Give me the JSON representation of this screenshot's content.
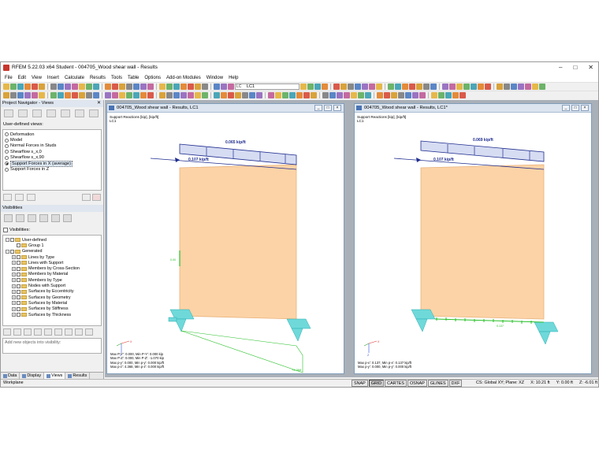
{
  "app": {
    "title": "RFEM 5.22.03 x64 Student - 004705_Wood shear wall - Results",
    "window_buttons": [
      "–",
      "□",
      "✕"
    ]
  },
  "menu": [
    "File",
    "Edit",
    "View",
    "Insert",
    "Calculate",
    "Results",
    "Tools",
    "Table",
    "Options",
    "Add-on Modules",
    "Window",
    "Help"
  ],
  "toolbar": {
    "load_case_tag": "LC",
    "load_case": "LC1"
  },
  "navigator": {
    "title": "Project Navigator - Views",
    "pin": "✕",
    "user_defined_label": "User-defined views:",
    "views": [
      {
        "label": "Deformation",
        "selected": false
      },
      {
        "label": "Model",
        "selected": false
      },
      {
        "label": "Normal Forces in Studs",
        "selected": false
      },
      {
        "label": "Shearflow s_x,0",
        "selected": false
      },
      {
        "label": "Shearflow s_x,90",
        "selected": false
      },
      {
        "label": "Support Forces in X (average)",
        "selected": true
      },
      {
        "label": "Support Forces in Z",
        "selected": false
      }
    ],
    "visibilities_title": "Visibilities",
    "visibilities_check": "Visibilities:",
    "tree": [
      {
        "label": "User-defined",
        "level": 0,
        "exp": "−"
      },
      {
        "label": "Group 1",
        "level": 1,
        "exp": ""
      },
      {
        "label": "Generated",
        "level": 0,
        "exp": "−"
      },
      {
        "label": "Lines by Type",
        "level": 1,
        "exp": "+"
      },
      {
        "label": "Lines with Support",
        "level": 1,
        "exp": "+"
      },
      {
        "label": "Members by Cross-Section",
        "level": 1,
        "exp": "+"
      },
      {
        "label": "Members by Material",
        "level": 1,
        "exp": "+"
      },
      {
        "label": "Members by Type",
        "level": 1,
        "exp": "+"
      },
      {
        "label": "Nodes with Support",
        "level": 1,
        "exp": "+"
      },
      {
        "label": "Surfaces by Eccentricity",
        "level": 1,
        "exp": "+"
      },
      {
        "label": "Surfaces by Geometry",
        "level": 1,
        "exp": "+"
      },
      {
        "label": "Surfaces by Material",
        "level": 1,
        "exp": "+"
      },
      {
        "label": "Surfaces by Stiffness",
        "level": 1,
        "exp": "+"
      },
      {
        "label": "Surfaces by Thickness",
        "level": 1,
        "exp": "+"
      }
    ],
    "add_placeholder": "Add new objects into visibility:",
    "tabs": [
      "Data",
      "Display",
      "Views",
      "Results"
    ],
    "active_tab": "Views"
  },
  "windows": [
    {
      "title": "004705_Wood shear wall - Results, LC1",
      "info1": "Support Reactions [kip], [kip/ft]",
      "info2": "LC1",
      "load_top": "0.065 kip/ft",
      "load_side": "0.107 kip/ft",
      "reaction_label": "0.00",
      "diagram_label": "+4.368",
      "maxmin": [
        "Max P-Y': 0.000, Min P-Y': 0.000 kip",
        "Max P-Z': 0.000, Min P-Z': -1.070 kip",
        "Max p-y': 0.000, Min p-y': 0.000 kip/ft",
        "Max p-z': 4.368, Min p-z': 0.000 kip/ft"
      ]
    },
    {
      "title": "004705_Wood shear wall - Results, LC1*",
      "info1": "Support Reactions [kip], [kip/ft]",
      "info2": "LC1",
      "load_top": "0.069 kip/ft",
      "load_side": "0.107 kip/ft",
      "reaction_label": "0.137",
      "maxmin": [
        "Max p-x': 0.137, Min p-x': 0.137 kip/ft",
        "Max p-y': 0.000, Min p-y': 0.000 kip/ft"
      ]
    }
  ],
  "statusbar": {
    "left": "Workplane",
    "toggles": [
      "SNAP",
      "GRID",
      "CARTES",
      "OSNAP",
      "GLINES",
      "DXF"
    ],
    "toggles_on": [
      "GRID"
    ],
    "cs": "CS: Global XY; Plane: XZ",
    "x": "X: 10.21 ft",
    "y": "Y: 0.00 ft",
    "z": "Z: -6.01 ft"
  },
  "colors": {
    "wall": "#fcd3a6",
    "wall_edge": "#e8b27c",
    "load_fill": "#d6dcf2",
    "load_arrow": "#1f2d8f",
    "support": "#6fd9da",
    "diagram": "#28c028"
  }
}
